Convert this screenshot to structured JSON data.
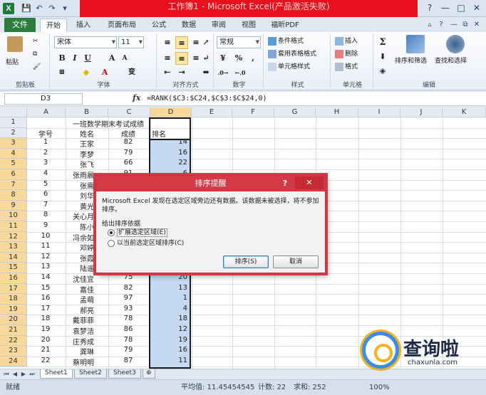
{
  "window": {
    "title": "工作簿1 - Microsoft Excel(产品激活失败)",
    "app_icon": "X",
    "controls": [
      "?",
      "—",
      "□",
      "✕"
    ]
  },
  "ribbon_tabs": {
    "file": "文件",
    "tabs": [
      "开始",
      "插入",
      "页面布局",
      "公式",
      "数据",
      "审阅",
      "视图",
      "福昕PDF"
    ],
    "active": "开始"
  },
  "ribbon": {
    "clipboard": {
      "paste": "粘贴",
      "label": "剪贴板"
    },
    "font": {
      "name": "宋体",
      "size": "11",
      "bold": "B",
      "italic": "I",
      "underline": "U",
      "grow": "A",
      "shrink": "A",
      "wen": "变",
      "label": "字体"
    },
    "alignment": {
      "label": "对齐方式"
    },
    "number": {
      "format": "常规",
      "percent": "%",
      "comma": ",",
      "label": "数字"
    },
    "styles": {
      "conditional": "条件格式",
      "table": "套用表格格式",
      "cell": "单元格样式",
      "label": "样式"
    },
    "cells": {
      "insert": "插入",
      "delete": "删除",
      "format": "格式",
      "label": "单元格"
    },
    "editing": {
      "sum": "Σ",
      "sort": "排序和筛选",
      "find": "查找和选择",
      "label": "编辑"
    }
  },
  "formula_bar": {
    "name_box": "D3",
    "fx": "fx",
    "formula": "=RANK($C3:$C24,$C$3:$C$24,0)"
  },
  "columns": [
    "A",
    "B",
    "C",
    "D",
    "E",
    "F",
    "G",
    "H",
    "I",
    "J",
    "K"
  ],
  "rows": [
    "1",
    "2",
    "3",
    "4",
    "5",
    "6",
    "7",
    "8",
    "9",
    "10",
    "11",
    "12",
    "13",
    "14",
    "15",
    "16",
    "17",
    "18",
    "19",
    "20",
    "21",
    "22",
    "23",
    "24"
  ],
  "sheet": {
    "title": "一班数学期末考试成绩",
    "headers": [
      "学号",
      "姓名",
      "成绩",
      "排名"
    ],
    "data": [
      [
        "1",
        "王家",
        "82",
        "14"
      ],
      [
        "2",
        "李梦",
        "79",
        "16"
      ],
      [
        "3",
        "张飞",
        "66",
        "22"
      ],
      [
        "4",
        "张雨晨",
        "91",
        "6"
      ],
      [
        "5",
        "张需",
        "",
        ""
      ],
      [
        "6",
        "刘华",
        "",
        ""
      ],
      [
        "7",
        "黄光",
        "",
        ""
      ],
      [
        "8",
        "关心月",
        "",
        ""
      ],
      [
        "9",
        "陈小",
        "",
        ""
      ],
      [
        "10",
        "冯余如",
        "",
        ""
      ],
      [
        "11",
        "邓婷",
        "",
        ""
      ],
      [
        "12",
        "张霞",
        "",
        ""
      ],
      [
        "13",
        "陆遥",
        "",
        ""
      ],
      [
        "14",
        "沈佳宜",
        "75",
        "20"
      ],
      [
        "15",
        "嘉佳",
        "82",
        "13"
      ],
      [
        "16",
        "孟萌",
        "97",
        "1"
      ],
      [
        "17",
        "郝亮",
        "93",
        "4"
      ],
      [
        "18",
        "戴菲菲",
        "78",
        "18"
      ],
      [
        "19",
        "袁梦洁",
        "86",
        "12"
      ],
      [
        "20",
        "庄秀成",
        "78",
        "19"
      ],
      [
        "21",
        "龚琳",
        "79",
        "16"
      ],
      [
        "22",
        "蔡明明",
        "87",
        "11"
      ]
    ]
  },
  "sheet_tabs": [
    "Sheet1",
    "Sheet2",
    "Sheet3"
  ],
  "status": {
    "ready": "就绪",
    "average": "平均值: 11.45454545",
    "count": "计数: 22",
    "sum": "求和: 252",
    "zoom": "100%"
  },
  "dialog": {
    "title": "排序提醒",
    "help": "?",
    "close": "✕",
    "message": "Microsoft Excel 发现在选定区域旁边还有数据。该数据未被选择，将不参加排序。",
    "group_label": "给出排序依据",
    "option1": "扩展选定区域(E)",
    "option2": "以当前选定区域排序(C)",
    "ok": "排序(S)",
    "cancel": "取消"
  },
  "watermark": {
    "text": "查询啦",
    "url": "chaxunla.com"
  }
}
